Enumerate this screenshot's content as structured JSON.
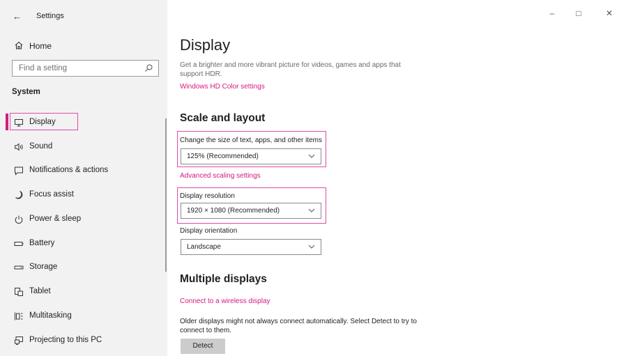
{
  "window": {
    "title": "Settings",
    "back_glyph": "←",
    "controls": {
      "minimize": "–",
      "maximize": "□",
      "close": "✕"
    }
  },
  "sidebar": {
    "home_label": "Home",
    "search_placeholder": "Find a setting",
    "section": "System",
    "items": [
      {
        "label": "Display",
        "icon": "monitor-icon",
        "selected": true
      },
      {
        "label": "Sound",
        "icon": "speaker-icon"
      },
      {
        "label": "Notifications & actions",
        "icon": "notification-icon"
      },
      {
        "label": "Focus assist",
        "icon": "moon-icon"
      },
      {
        "label": "Power & sleep",
        "icon": "power-icon"
      },
      {
        "label": "Battery",
        "icon": "battery-icon"
      },
      {
        "label": "Storage",
        "icon": "storage-icon"
      },
      {
        "label": "Tablet",
        "icon": "tablet-icon"
      },
      {
        "label": "Multitasking",
        "icon": "multitasking-icon"
      },
      {
        "label": "Projecting to this PC",
        "icon": "projecting-icon"
      }
    ]
  },
  "main": {
    "title": "Display",
    "hdr_desc": "Get a brighter and more vibrant picture for videos, games and apps that support HDR.",
    "hdr_link": "Windows HD Color settings",
    "scale_heading": "Scale and layout",
    "scale_label": "Change the size of text, apps, and other items",
    "scale_value": "125% (Recommended)",
    "advanced_link": "Advanced scaling settings",
    "resolution_label": "Display resolution",
    "resolution_value": "1920 × 1080 (Recommended)",
    "orientation_label": "Display orientation",
    "orientation_value": "Landscape",
    "multi_heading": "Multiple displays",
    "wireless_link": "Connect to a wireless display",
    "detect_desc": "Older displays might not always connect automatically. Select Detect to try to connect to them.",
    "detect_button": "Detect"
  },
  "colors": {
    "accent": "#d4197f",
    "highlight": "#e04aa5",
    "sidebar_bg": "#f2f2f2"
  }
}
